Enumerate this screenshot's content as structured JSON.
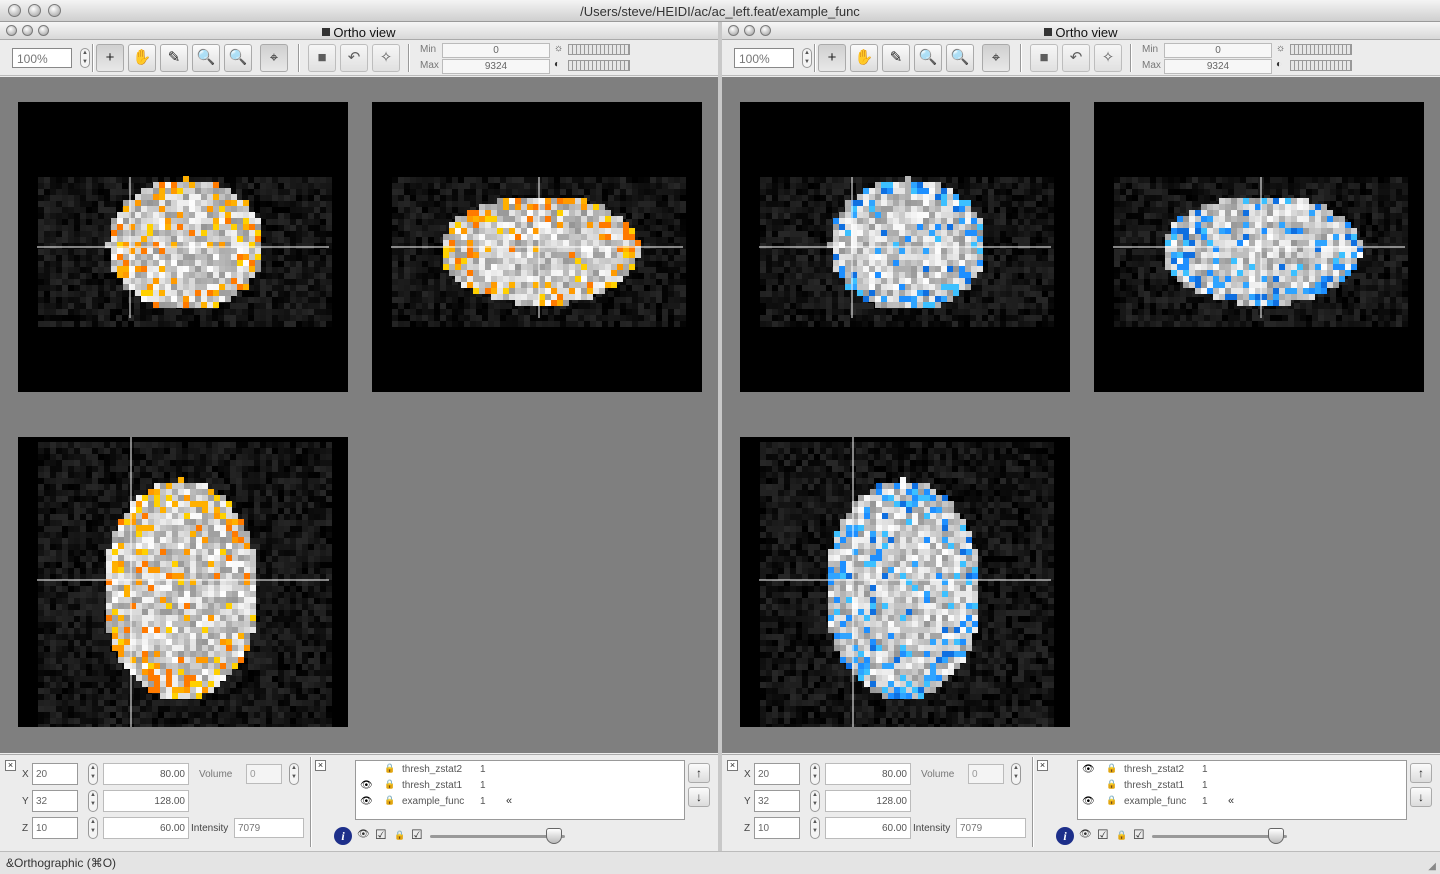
{
  "window": {
    "title": "/Users/steve/HEIDI/ac/ac_left.feat/example_func"
  },
  "status": {
    "text": "&Orthographic (⌘O)"
  },
  "panes": [
    {
      "title": "Ortho view",
      "zoom": "100%",
      "min_label": "Min",
      "min_value": "0",
      "max_label": "Max",
      "max_value": "9324",
      "overlay_color": "#ff9a00",
      "coords": {
        "x_label": "X",
        "x": "20",
        "y_label": "Y",
        "y": "32",
        "z_label": "Z",
        "z": "10",
        "mx": "80.00",
        "my": "128.00",
        "mz": "60.00",
        "volume_label": "Volume",
        "volume": "0",
        "intensity_label": "Intensity",
        "intensity": "7079"
      },
      "layers": [
        {
          "name": "thresh_zstat2",
          "value": "1",
          "visible": false
        },
        {
          "name": "thresh_zstat1",
          "value": "1",
          "visible": true
        },
        {
          "name": "example_func",
          "value": "1",
          "visible": true
        }
      ]
    },
    {
      "title": "Ortho view",
      "zoom": "100%",
      "min_label": "Min",
      "min_value": "0",
      "max_label": "Max",
      "max_value": "9324",
      "overlay_color": "#1e8fff",
      "coords": {
        "x_label": "X",
        "x": "20",
        "y_label": "Y",
        "y": "32",
        "z_label": "Z",
        "z": "10",
        "mx": "80.00",
        "my": "128.00",
        "mz": "60.00",
        "volume_label": "Volume",
        "volume": "0",
        "intensity_label": "Intensity",
        "intensity": "7079"
      },
      "layers": [
        {
          "name": "thresh_zstat2",
          "value": "1",
          "visible": true
        },
        {
          "name": "thresh_zstat1",
          "value": "1",
          "visible": false
        },
        {
          "name": "example_func",
          "value": "1",
          "visible": true
        }
      ]
    }
  ],
  "icons": {
    "crosshair_tool": "+",
    "pan_tool": "✋",
    "pencil_tool": "✎",
    "zoom_tool": "🔍",
    "eye": "👁",
    "lock": "🔒",
    "checkbox": "☑",
    "up": "↑",
    "down": "↓",
    "info": "i",
    "mark": "«"
  }
}
